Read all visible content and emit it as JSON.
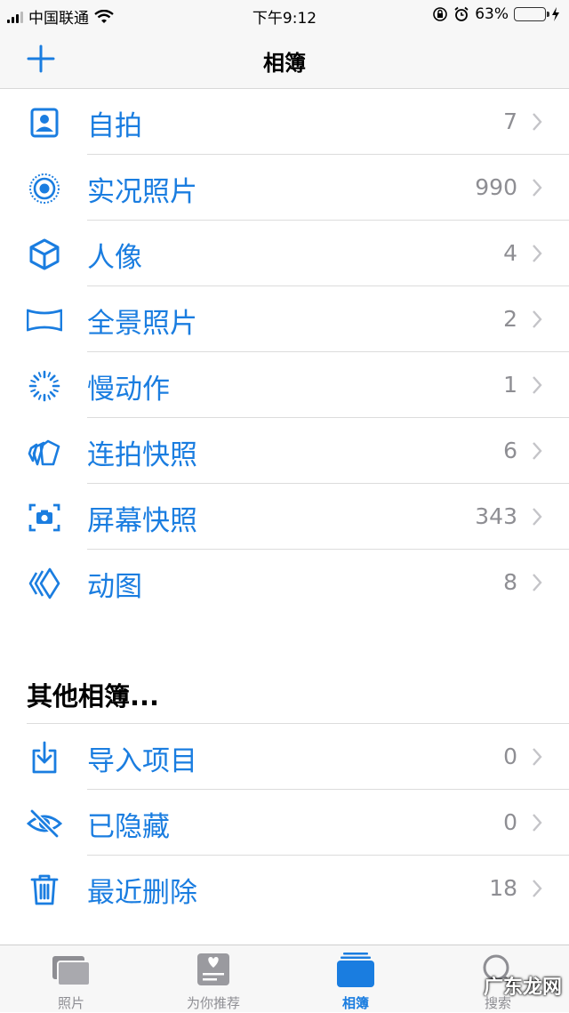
{
  "status": {
    "carrier": "中国联通",
    "time": "下午9:12",
    "battery": "63%",
    "battery_level": 0.63
  },
  "nav": {
    "title": "相簿"
  },
  "media_types": [
    {
      "label": "自拍",
      "count": "7",
      "icon": "portrait-icon"
    },
    {
      "label": "实况照片",
      "count": "990",
      "icon": "live-photo-icon"
    },
    {
      "label": "人像",
      "count": "4",
      "icon": "cube-icon"
    },
    {
      "label": "全景照片",
      "count": "2",
      "icon": "panorama-icon"
    },
    {
      "label": "慢动作",
      "count": "1",
      "icon": "slow-motion-icon"
    },
    {
      "label": "连拍快照",
      "count": "6",
      "icon": "burst-icon"
    },
    {
      "label": "屏幕快照",
      "count": "343",
      "icon": "screenshot-icon"
    },
    {
      "label": "动图",
      "count": "8",
      "icon": "animated-icon"
    }
  ],
  "other_albums": {
    "title": "其他相簿...",
    "items": [
      {
        "label": "导入项目",
        "count": "0",
        "icon": "import-icon"
      },
      {
        "label": "已隐藏",
        "count": "0",
        "icon": "hidden-eye-icon"
      },
      {
        "label": "最近删除",
        "count": "18",
        "icon": "trash-icon"
      }
    ]
  },
  "tabs": [
    {
      "label": "照片",
      "icon": "photos-icon"
    },
    {
      "label": "为你推荐",
      "icon": "for-you-icon"
    },
    {
      "label": "相簿",
      "icon": "albums-icon"
    },
    {
      "label": "搜索",
      "icon": "search-icon"
    }
  ],
  "watermark": "广东龙网",
  "colors": {
    "accent": "#1a7de0",
    "count_gray": "#8e8e93",
    "battery_green": "#4cd964"
  }
}
